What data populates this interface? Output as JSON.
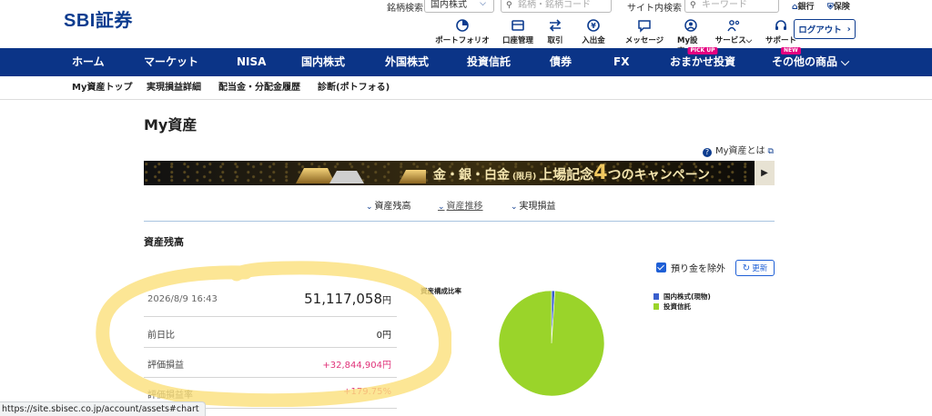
{
  "brand": {
    "logo": "SBI証券",
    "primary": "#0b3487",
    "accent": "#e4007f",
    "positive": "#e0337a"
  },
  "header": {
    "stock_search_label": "銘柄検索",
    "market_select": "国内株式",
    "stock_search_placeholder": "銘柄・銘柄コード",
    "site_search_label": "サイト内検索",
    "site_search_placeholder": "キーワード",
    "bank_link": "銀行",
    "insurance_link": "保険",
    "icons": [
      {
        "label": "ポートフォリオ",
        "icon": "portfolio-icon"
      },
      {
        "label": "口座管理",
        "icon": "account-icon"
      },
      {
        "label": "取引",
        "icon": "trade-icon"
      },
      {
        "label": "入出金",
        "icon": "deposit-icon"
      },
      {
        "label": "メッセージ",
        "icon": "message-icon"
      },
      {
        "label": "My設定",
        "icon": "settings-icon"
      },
      {
        "label": "サービス",
        "icon": "service-icon"
      },
      {
        "label": "サポート",
        "icon": "support-icon"
      }
    ],
    "logout": "ログアウト"
  },
  "mainnav": {
    "items": [
      "ホーム",
      "マーケット",
      "NISA",
      "国内株式",
      "外国株式",
      "投資信託",
      "債券",
      "FX",
      "おまかせ投資",
      "その他の商品"
    ],
    "pickup_tag": "PICK UP",
    "new_tag": "NEW"
  },
  "subnav": {
    "items": [
      "My資産トップ",
      "実現損益詳細",
      "配当金・分配金履歴",
      "診断(ポトフォる)"
    ]
  },
  "page": {
    "title": "My資産",
    "help_link": "My資産とは",
    "banner": {
      "prefix": "金・銀・白金",
      "paren": "(限月)",
      "main": "上場記念",
      "num": "4",
      "suffix1": "つ",
      "suffix2": "のキャンペーン"
    },
    "anchors": [
      "資産残高",
      "資産推移",
      "実現損益"
    ],
    "section_title": "資産残高",
    "exclude_deposit": "預り金を除外",
    "refresh": "更新",
    "summary": {
      "timestamp": "2026/8/9 16:43",
      "total": "51,117,058",
      "unit": "円",
      "rows": [
        {
          "label": "前日比",
          "value": "0円"
        },
        {
          "label": "評価損益",
          "value": "+32,844,904円"
        },
        {
          "label": "評価損益率",
          "value": "+179.75%"
        }
      ]
    },
    "chart_caption": "資産構成比率"
  },
  "chart_data": {
    "type": "pie",
    "title": "資産構成比率",
    "slices": [
      {
        "name": "国内株式(現物)",
        "value": 1,
        "color": "#3a5fcd"
      },
      {
        "name": "投資信託",
        "value": 99,
        "color": "#9ad42a"
      }
    ],
    "legend": "right"
  },
  "statusbar": "https://site.sbisec.co.jp/account/assets#chart"
}
